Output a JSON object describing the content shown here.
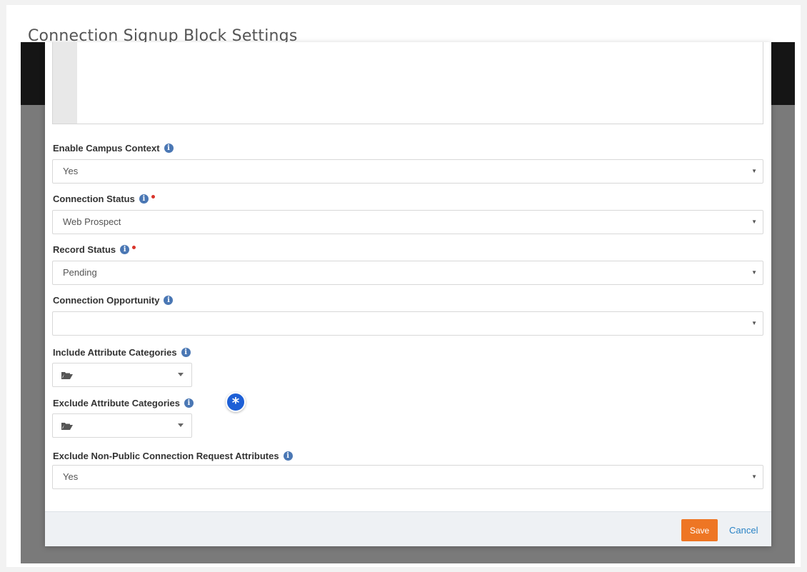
{
  "page_title": "Connection Signup Block Settings",
  "fields": {
    "enable_campus_context": {
      "label": "Enable Campus Context",
      "value": "Yes"
    },
    "connection_status": {
      "label": "Connection Status",
      "value": "Web Prospect",
      "required": true
    },
    "record_status": {
      "label": "Record Status",
      "value": "Pending",
      "required": true
    },
    "connection_opportunity": {
      "label": "Connection Opportunity",
      "value": ""
    },
    "include_attribute_categories": {
      "label": "Include Attribute Categories"
    },
    "exclude_attribute_categories": {
      "label": "Exclude Attribute Categories"
    },
    "exclude_non_public": {
      "label": "Exclude Non-Public Connection Request Attributes",
      "value": "Yes"
    }
  },
  "footer": {
    "save_label": "Save",
    "cancel_label": "Cancel"
  },
  "icons": {
    "info": "info-icon",
    "folder": "folder-icon",
    "dropdown": "caret-down-icon",
    "badge": "asterisk-icon"
  },
  "colors": {
    "accent_save": "#ee7624",
    "link": "#2a83c5",
    "info_icon": "#4a77b4",
    "required": "#d9342b",
    "badge": "#1d5fd6"
  }
}
